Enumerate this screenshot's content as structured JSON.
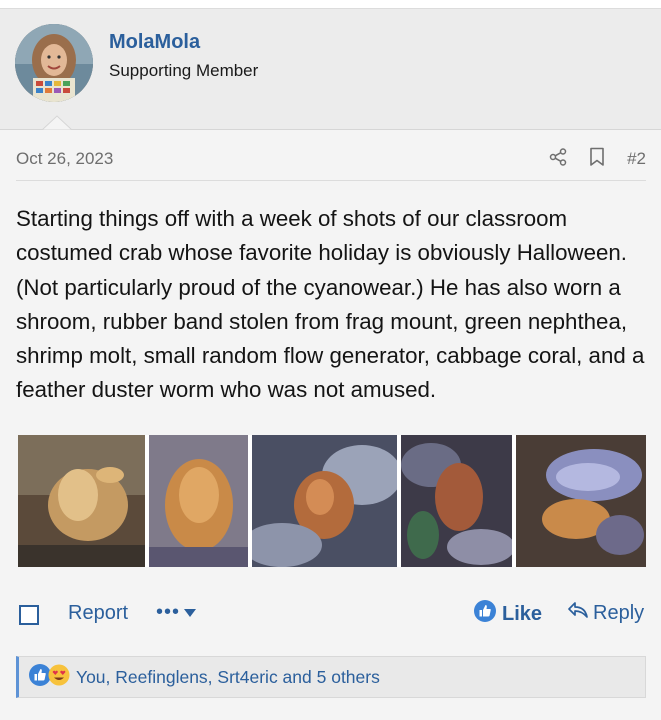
{
  "user": {
    "name": "MolaMola",
    "title": "Supporting Member"
  },
  "post": {
    "date": "Oct 26, 2023",
    "number": "#2",
    "body": "Starting things off with a week of shots of our classroom costumed crab whose favorite holiday is obviously Halloween. (Not particularly proud of the cyanowear.) He has also worn a shroom, rubber band stolen from frag mount, green nephthea, shrimp molt, small random flow generator, cabbage coral, and a feather duster worm who was not amused."
  },
  "actions": {
    "report_label": "Report",
    "more_label": "•••",
    "like_label": "Like",
    "reply_label": "Reply"
  },
  "reactions": {
    "summary": "You, Reefinglens, Srt4eric and 5 others"
  },
  "icons": [
    "share-icon",
    "bookmark-icon",
    "like-thumb-icon",
    "reply-icon",
    "love-emoji-icon"
  ],
  "colors": {
    "link": "#2b5f9c",
    "like_bubble": "#3b82d6",
    "meta_grey": "#6e6e6e"
  }
}
